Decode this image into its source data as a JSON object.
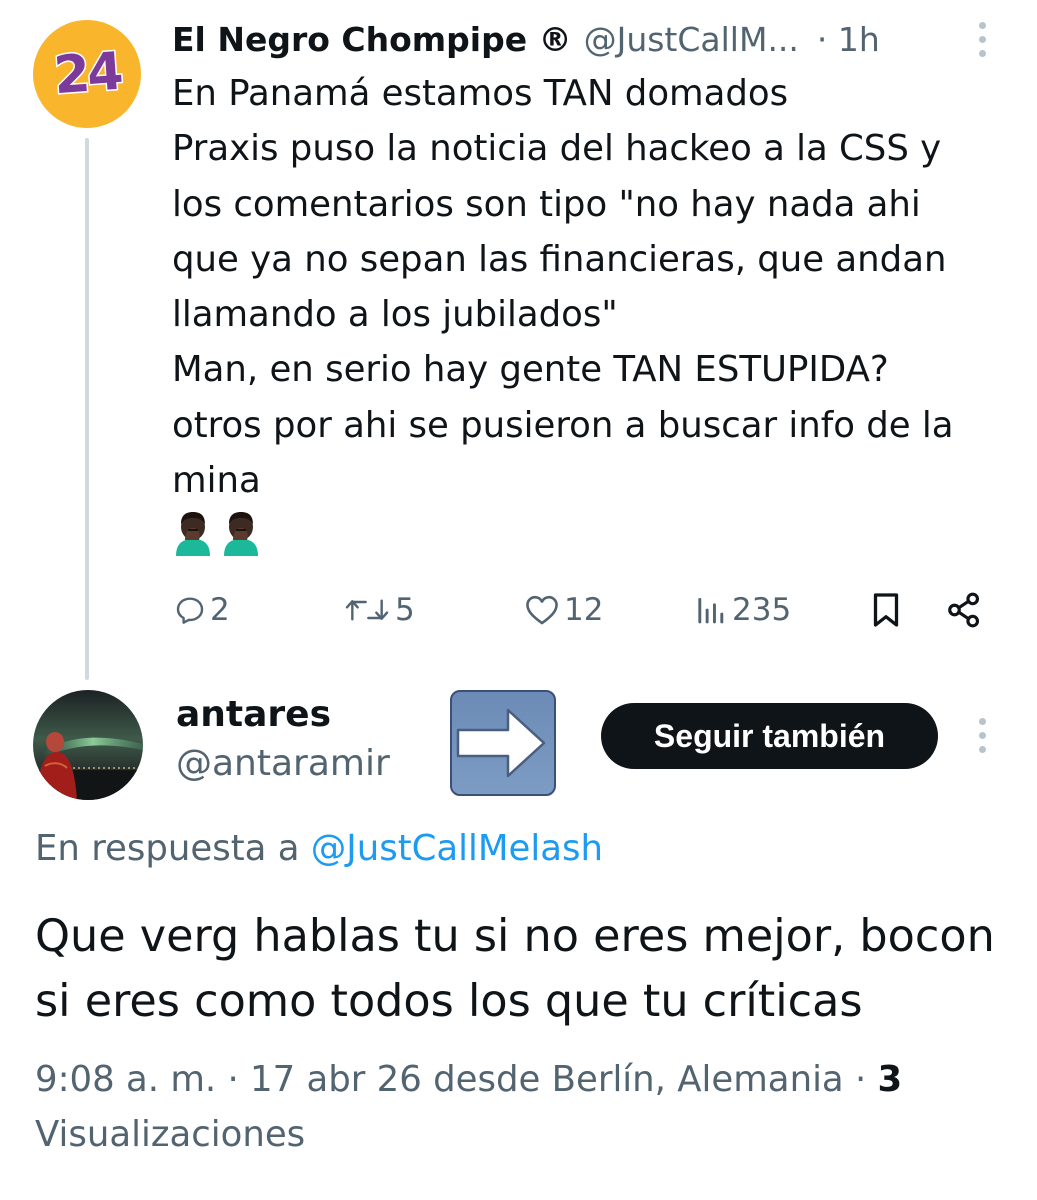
{
  "parent_tweet": {
    "avatar_text": "24",
    "author_name": "El Negro Chompipe ®",
    "author_handle": "@JustCallM...",
    "timestamp": "· 1h",
    "body_lines": [
      "En Panamá estamos TAN domados",
      "Praxis puso la noticia del hackeo a la CSS y",
      "los comentarios son tipo \"no hay nada ahi",
      "que ya no sepan las financieras, que andan",
      "llamando a los jubilados\"",
      "Man, en serio hay gente TAN ESTUPIDA?",
      "otros por ahi se pusieron a buscar info de la",
      "mina"
    ],
    "emojis": [
      "man-facepalming-dark-skin",
      "man-facepalming-dark-skin"
    ],
    "actions": {
      "replies": "2",
      "reposts": "5",
      "likes": "12",
      "views": "235"
    }
  },
  "reply_tweet": {
    "author_name": "antares",
    "author_handle": "@antaramir",
    "follow_label": "Seguir también",
    "reply_to_prefix": "En respuesta a",
    "reply_to_handle": "@JustCallMelash",
    "body_lines": [
      "Que verg hablas tu si no eres mejor, bocon",
      "si eres como todos los que tu críticas"
    ],
    "meta_time": "9:08 a. m. · 17 abr 26 desde Berlín, Alemania · ",
    "meta_views_count": "3",
    "meta_views_label": "Visualizaciones"
  },
  "icons": {
    "reply": "speech-bubble-icon",
    "repost": "repost-arrows-icon",
    "like": "heart-icon",
    "views": "bar-chart-icon",
    "bookmark": "bookmark-icon",
    "share": "share-icon",
    "more": "vertical-ellipsis-icon",
    "arrow": "right-arrow-icon"
  },
  "colors": {
    "text": "#0f1419",
    "secondary_text": "#536471",
    "link": "#1d9bf0",
    "avatar_24_bg": "#f9b52b",
    "follow_button_bg": "#0f1419"
  }
}
